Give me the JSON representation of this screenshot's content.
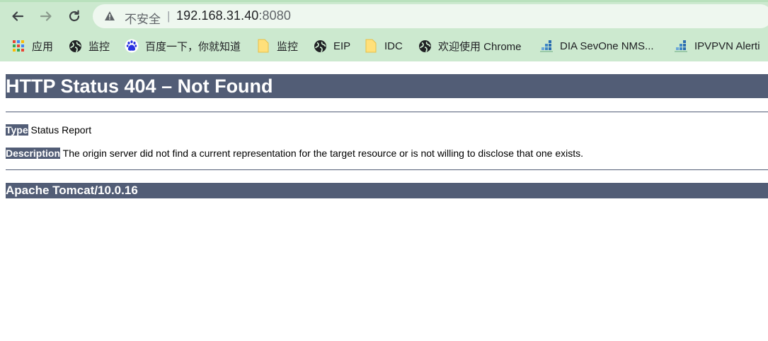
{
  "browser": {
    "address": {
      "security_label": "不安全",
      "separator": "|",
      "host": "192.168.31.40",
      "port": ":8080"
    },
    "bookmarks": [
      {
        "label": "应用",
        "icon": "apps-grid-icon"
      },
      {
        "label": "监控",
        "icon": "globe-icon"
      },
      {
        "label": "百度一下，你就知道",
        "icon": "baidu-paw-icon"
      },
      {
        "label": "监控",
        "icon": "folder-icon"
      },
      {
        "label": "EIP",
        "icon": "globe-icon"
      },
      {
        "label": "IDC",
        "icon": "folder-icon"
      },
      {
        "label": "欢迎使用 Chrome",
        "icon": "globe-icon"
      },
      {
        "label": "DIA SevOne NMS...",
        "icon": "sevone-icon"
      },
      {
        "label": "IPVPVN Alerti",
        "icon": "sevone-icon"
      }
    ]
  },
  "page": {
    "heading": "HTTP Status 404 – Not Found",
    "type_label": "Type",
    "type_value": " Status Report",
    "description_label": "Description",
    "description_value": " The origin server did not find a current representation for the target resource or is not willing to disclose that one exists.",
    "footer": "Apache Tomcat/10.0.16"
  },
  "colors": {
    "tomcat_bar": "#525d76",
    "chrome_bg": "#cce9cf"
  }
}
